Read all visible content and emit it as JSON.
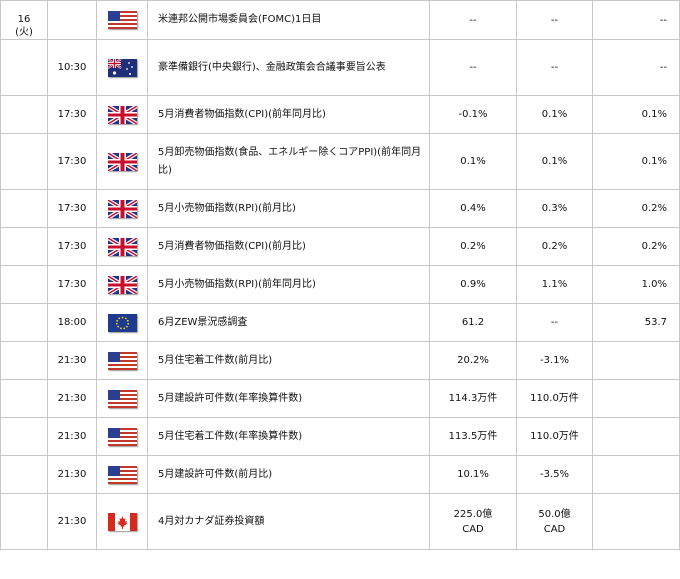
{
  "date": {
    "day": "16",
    "weekday": "(火)"
  },
  "rows": [
    {
      "time": "",
      "flag": "us-flag-icon",
      "event": "米連邦公開市場委員会(FOMC)1日目",
      "prev": "--",
      "forecast": "--",
      "actual": "--"
    },
    {
      "time": "10:30",
      "flag": "au-flag-icon",
      "event": "豪準備銀行(中央銀行)、金融政策会合議事要旨公表",
      "prev": "--",
      "forecast": "--",
      "actual": "--"
    },
    {
      "time": "17:30",
      "flag": "uk-flag-icon",
      "event": "5月消費者物価指数(CPI)(前年同月比)",
      "prev": "-0.1%",
      "forecast": "0.1%",
      "actual": "0.1%"
    },
    {
      "time": "17:30",
      "flag": "uk-flag-icon",
      "event": "5月卸売物価指数(食品、エネルギー除くコアPPI)(前年同月比)",
      "prev": "0.1%",
      "forecast": "0.1%",
      "actual": "0.1%"
    },
    {
      "time": "17:30",
      "flag": "uk-flag-icon",
      "event": "5月小売物価指数(RPI)(前月比)",
      "prev": "0.4%",
      "forecast": "0.3%",
      "actual": "0.2%"
    },
    {
      "time": "17:30",
      "flag": "uk-flag-icon",
      "event": "5月消費者物価指数(CPI)(前月比)",
      "prev": "0.2%",
      "forecast": "0.2%",
      "actual": "0.2%"
    },
    {
      "time": "17:30",
      "flag": "uk-flag-icon",
      "event": "5月小売物価指数(RPI)(前年同月比)",
      "prev": "0.9%",
      "forecast": "1.1%",
      "actual": "1.0%"
    },
    {
      "time": "18:00",
      "flag": "eu-flag-icon",
      "event": "6月ZEW景況感調査",
      "prev": "61.2",
      "forecast": "--",
      "actual": "53.7"
    },
    {
      "time": "21:30",
      "flag": "us-flag-icon",
      "event": "5月住宅着工件数(前月比)",
      "prev": "20.2%",
      "forecast": "-3.1%",
      "actual": ""
    },
    {
      "time": "21:30",
      "flag": "us-flag-icon",
      "event": "5月建設許可件数(年率換算件数)",
      "prev": "114.3万件",
      "forecast": "110.0万件",
      "actual": ""
    },
    {
      "time": "21:30",
      "flag": "us-flag-icon",
      "event": "5月住宅着工件数(年率換算件数)",
      "prev": "113.5万件",
      "forecast": "110.0万件",
      "actual": ""
    },
    {
      "time": "21:30",
      "flag": "us-flag-icon",
      "event": "5月建設許可件数(前月比)",
      "prev": "10.1%",
      "forecast": "-3.5%",
      "actual": ""
    },
    {
      "time": "21:30",
      "flag": "ca-flag-icon",
      "event": "4月対カナダ証券投資額",
      "prev": "225.0億\nCAD",
      "forecast": "50.0億\nCAD",
      "actual": ""
    }
  ]
}
